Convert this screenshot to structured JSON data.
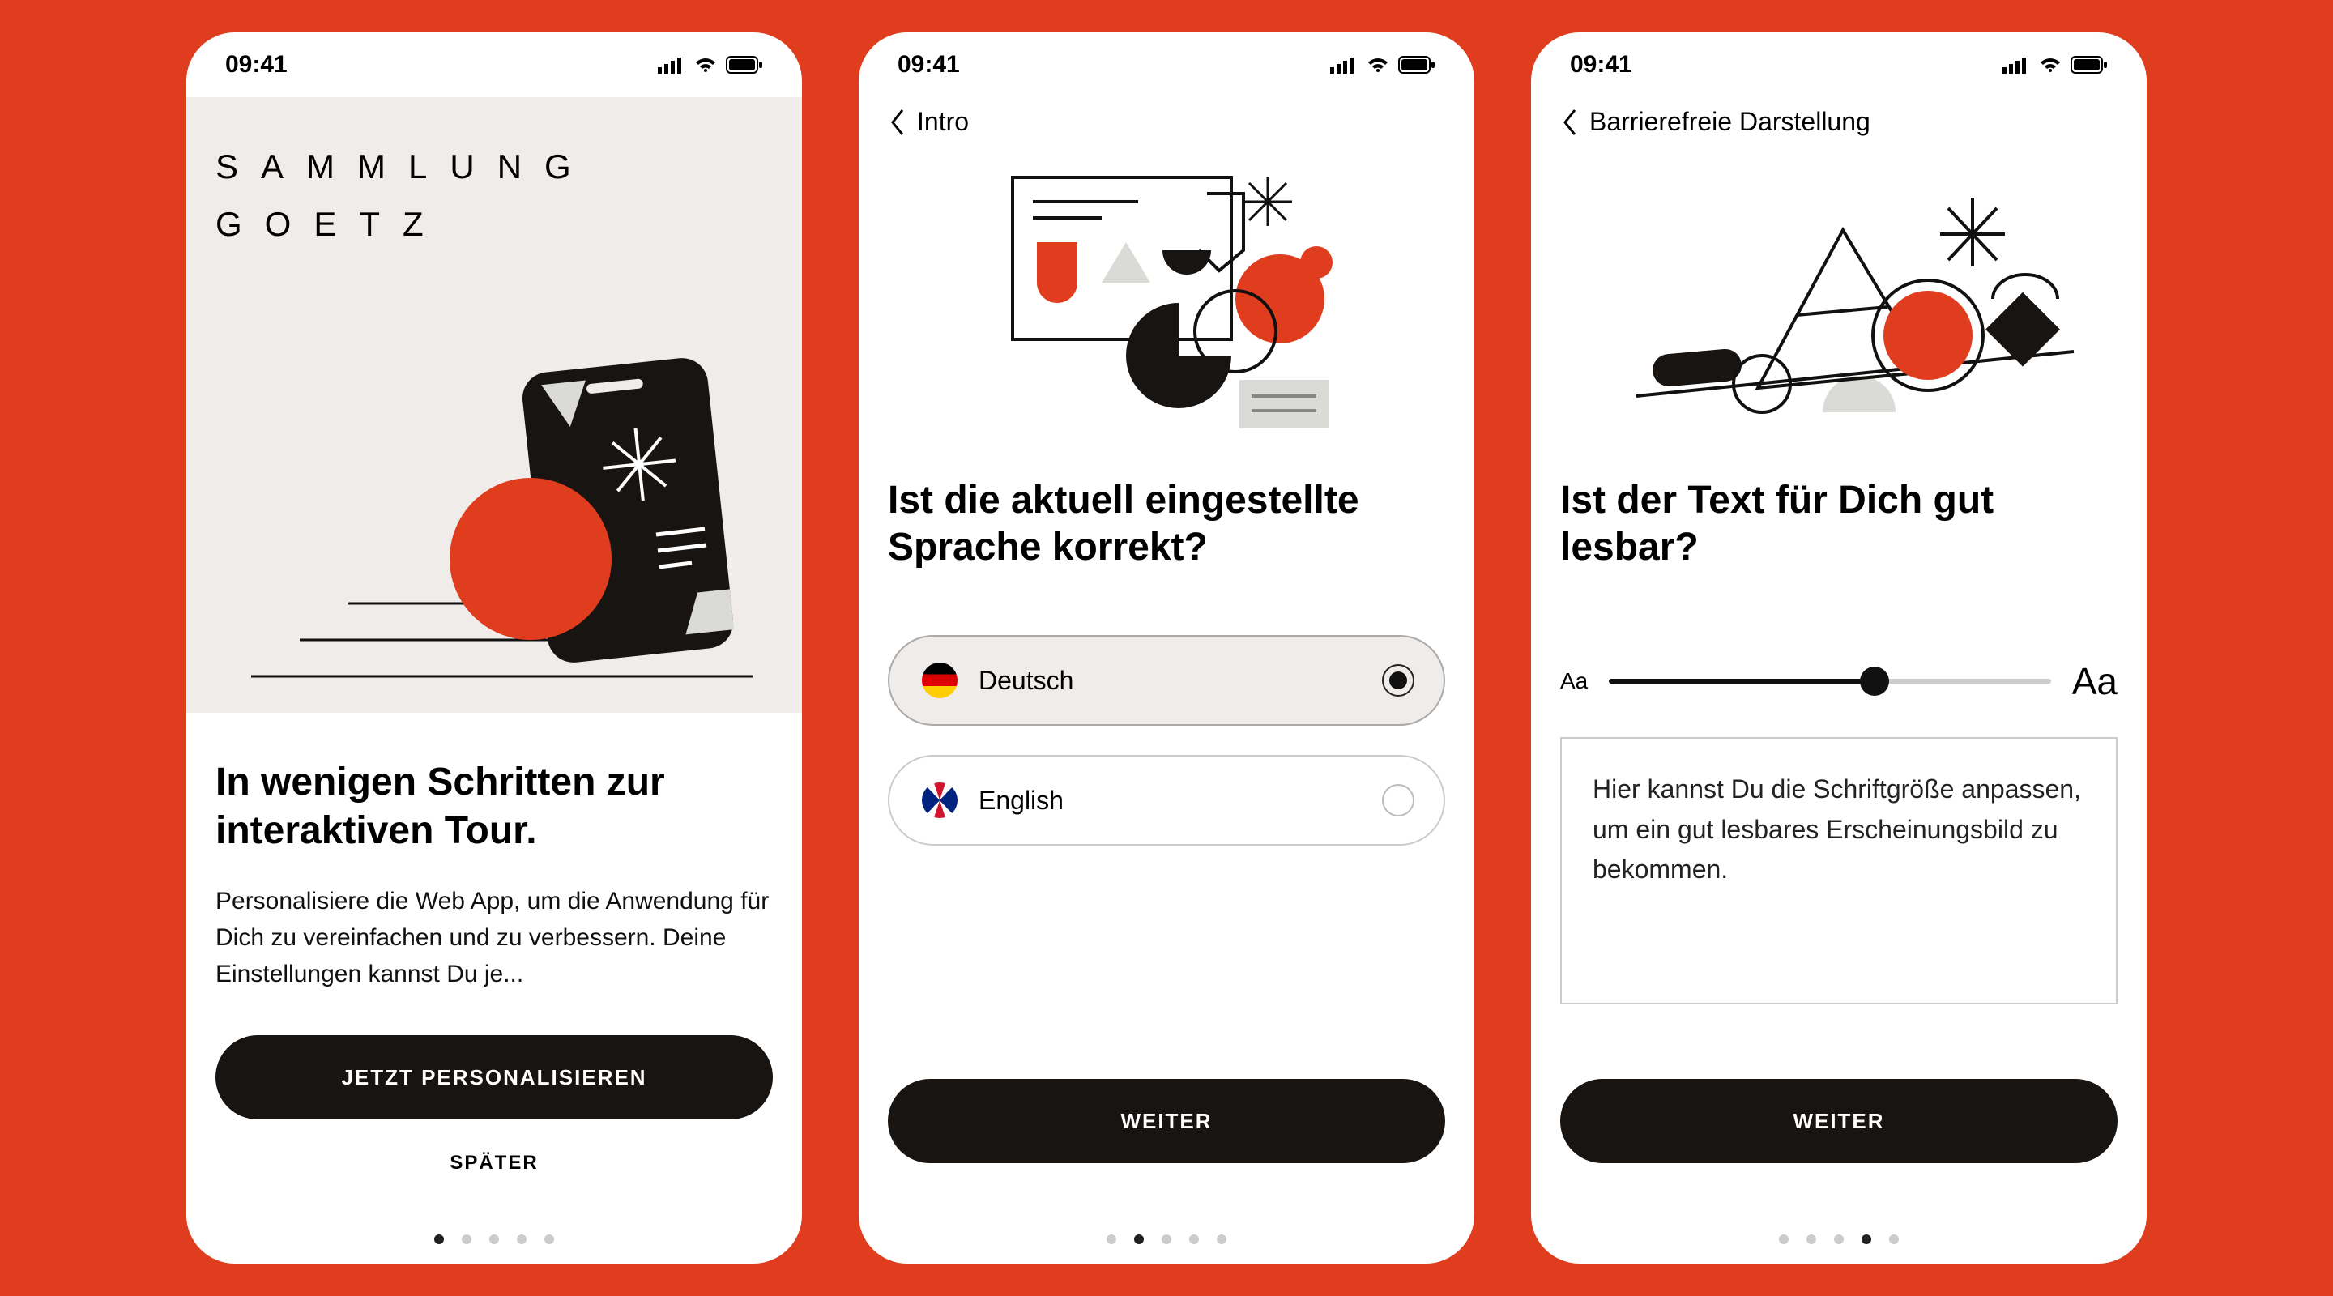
{
  "status": {
    "time": "09:41"
  },
  "brand": {
    "line1": "SAMMLUNG",
    "line2": "GOETZ"
  },
  "screen1": {
    "heading": "In wenigen Schritten zur interaktiven Tour.",
    "body": "Personalisiere die Web App, um die Anwendung für Dich zu vereinfachen und zu verbessern. Deine Einstellungen kannst Du je...",
    "primary_button": "JETZT PERSONALISIEREN",
    "secondary_button": "SPÄTER",
    "page_index": 0,
    "page_count": 5
  },
  "screen2": {
    "back_label": "Intro",
    "heading": "Ist die aktuell eingestellte Sprache korrekt?",
    "options": [
      {
        "label": "Deutsch",
        "selected": true,
        "flag": "de"
      },
      {
        "label": "English",
        "selected": false,
        "flag": "en"
      }
    ],
    "primary_button": "WEITER",
    "page_index": 1,
    "page_count": 5
  },
  "screen3": {
    "back_label": "Barrierefreie Darstellung",
    "heading": "Ist der Text für Dich gut lesbar?",
    "slider": {
      "min_label": "Aa",
      "max_label": "Aa",
      "value_percent": 60
    },
    "preview_text": "Hier kannst Du die Schriftgröße anpassen, um ein gut lesbares Erscheinungsbild zu bekommen.",
    "primary_button": "WEITER",
    "page_index": 3,
    "page_count": 5
  },
  "colors": {
    "accent": "#E03C1E",
    "dark": "#181412"
  }
}
